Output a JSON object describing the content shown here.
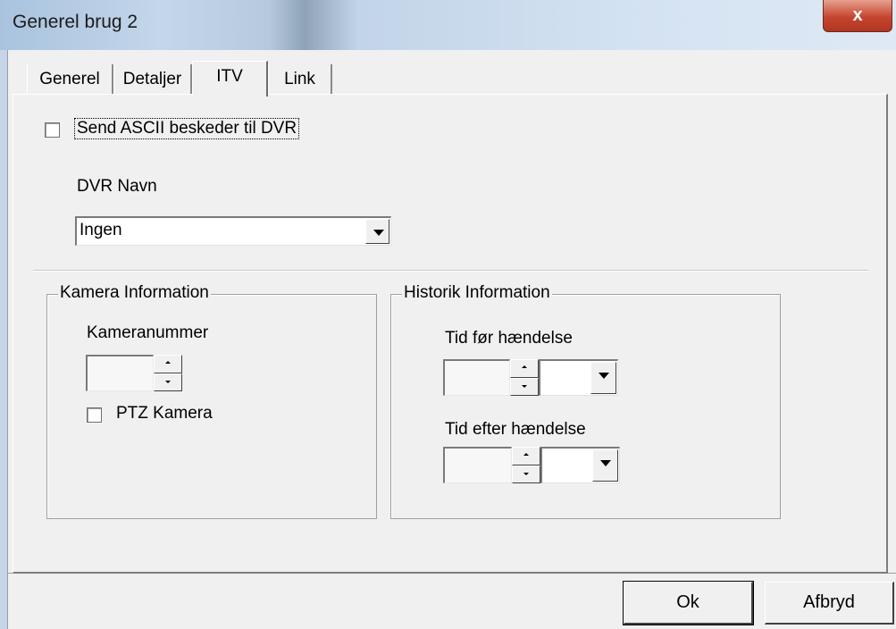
{
  "window": {
    "title": "Generel brug 2",
    "close_glyph": "x"
  },
  "tabs": [
    {
      "label": "Generel",
      "active": false
    },
    {
      "label": "Detaljer",
      "active": false
    },
    {
      "label": "ITV",
      "active": true
    },
    {
      "label": "Link",
      "active": false
    }
  ],
  "itv": {
    "send_ascii_label": "Send ASCII beskeder til DVR",
    "send_ascii_checked": false,
    "dvr_name_label": "DVR Navn",
    "dvr_name_value": "Ingen"
  },
  "camera_group": {
    "title": "Kamera Information",
    "camera_number_label": "Kameranummer",
    "camera_number_value": "",
    "ptz_label": "PTZ Kamera",
    "ptz_checked": false
  },
  "history_group": {
    "title": "Historik Information",
    "before_label": "Tid før hændelse",
    "before_value": "",
    "before_unit": "",
    "after_label": "Tid efter hændelse",
    "after_value": "",
    "after_unit": ""
  },
  "buttons": {
    "ok": "Ok",
    "cancel": "Afbryd"
  },
  "colors": {
    "titlebar": "#c4d6ea",
    "close_button": "#c5452f",
    "dialog_bg": "#f0f0f0"
  }
}
